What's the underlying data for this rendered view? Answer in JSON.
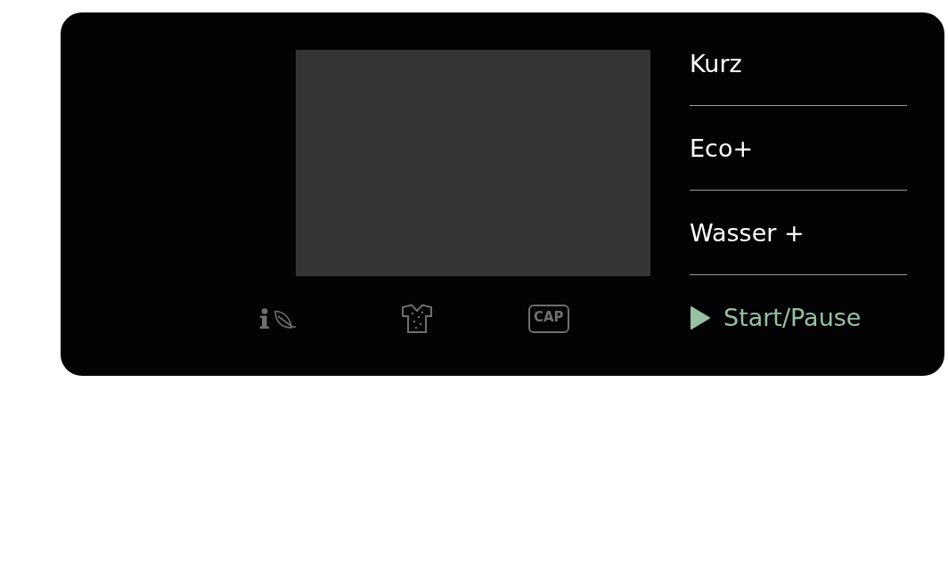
{
  "indicators": [
    {
      "kind": "eco-info"
    },
    {
      "kind": "shirt"
    },
    {
      "kind": "cap",
      "label": "CAP"
    }
  ],
  "programs": [
    {
      "kind": "option",
      "label": "Kurz"
    },
    {
      "kind": "option",
      "label": "Eco+"
    },
    {
      "kind": "option",
      "label": "Wasser +"
    },
    {
      "kind": "start",
      "label": "Start/Pause"
    }
  ]
}
